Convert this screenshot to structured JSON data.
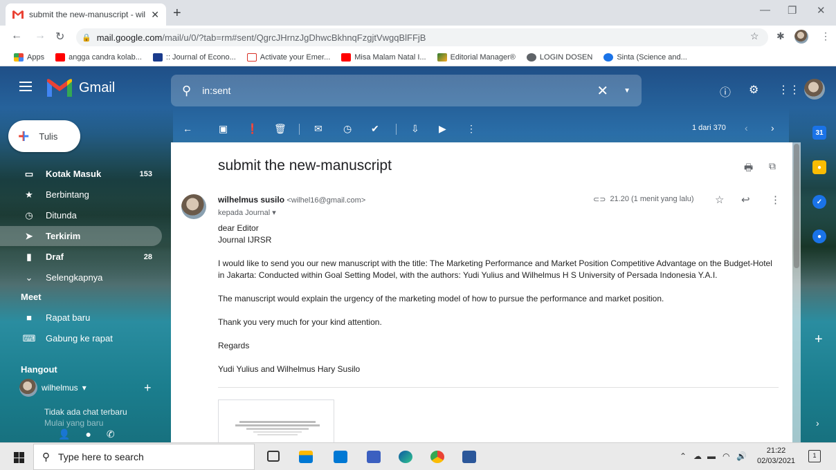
{
  "browser": {
    "tab_title": "submit the new-manuscript - wil",
    "url_host": "mail.google.com",
    "url_path": "/mail/u/0/?tab=rm#sent/QgrcJHrnzJgDhwcBkhnqFzgjtVwgqBlFFjB",
    "bookmarks": [
      {
        "label": "Apps",
        "color": "#ea4335"
      },
      {
        "label": "angga candra kolab...",
        "color": "#ff0000"
      },
      {
        "label": ":: Journal of Econo...",
        "color": "#1a3b8c"
      },
      {
        "label": "Activate your Emer...",
        "color": "#d93025"
      },
      {
        "label": "Misa Malam Natal I...",
        "color": "#ff0000"
      },
      {
        "label": "Editorial Manager®",
        "color": "#2e7d32"
      },
      {
        "label": "LOGIN DOSEN",
        "color": "#5f6368"
      },
      {
        "label": "Sinta (Science and...",
        "color": "#1a73e8"
      }
    ]
  },
  "gmail": {
    "brand": "Gmail",
    "search_query": "in:sent",
    "compose_label": "Tulis",
    "nav": [
      {
        "label": "Kotak Masuk",
        "count": "153",
        "icon": "inbox-icon"
      },
      {
        "label": "Berbintang",
        "count": "",
        "icon": "star-icon"
      },
      {
        "label": "Ditunda",
        "count": "",
        "icon": "clock-icon"
      },
      {
        "label": "Terkirim",
        "count": "",
        "icon": "send-icon"
      },
      {
        "label": "Draf",
        "count": "28",
        "icon": "draft-icon"
      },
      {
        "label": "Selengkapnya",
        "count": "",
        "icon": "chevron-down-icon"
      }
    ],
    "meet": {
      "title": "Meet",
      "new_meeting": "Rapat baru",
      "join_meeting": "Gabung ke rapat"
    },
    "hangout": {
      "title": "Hangout",
      "user": "wilhelmus",
      "no_chat": "Tidak ada chat terbaru",
      "start_new": "Mulai yang baru"
    },
    "pager": "1 dari 370",
    "message": {
      "subject": "submit the new-manuscript",
      "sender_name": "wilhelmus susilo",
      "sender_email": "<wilhel16@gmail.com>",
      "to": "kepada Journal",
      "time": "21.20 (1 menit yang lalu)",
      "body": [
        "dear Editor",
        "Journal IJRSR",
        "I would like to send you our new manuscript with the title: The Marketing Performance and Market Position Competitive Advantage on the Budget-Hotel in Jakarta: Conducted within Goal Setting Model, with the authors: Yudi Yulius and Wilhelmus H S University of Persada Indonesia Y.A.I.",
        "The manuscript would explain the urgency of the marketing model of how to pursue the performance and market position.",
        "Thank you very much for your kind attention.",
        "Regards",
        "Yudi Yulius and Wilhelmus Hary Susilo"
      ]
    }
  },
  "taskbar": {
    "search_placeholder": "Type here to search",
    "time": "21:22",
    "date": "02/03/2021",
    "notification_count": "1"
  },
  "colors": {
    "gmail_red": "#ea4335",
    "gmail_blue": "#4285f4",
    "pane_bg": "#ffffff"
  }
}
